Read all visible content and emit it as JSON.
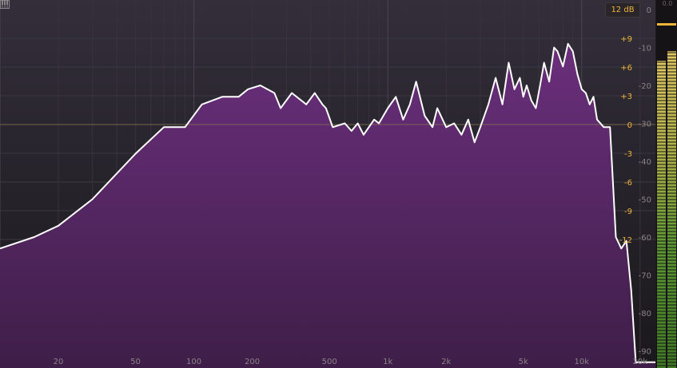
{
  "range_button": {
    "label": "12 dB"
  },
  "meter": {
    "peak_readout": "0.0",
    "level_db": -11
  },
  "freq_axis": {
    "ticks": [
      {
        "label": "20",
        "hz": 20
      },
      {
        "label": "50",
        "hz": 50
      },
      {
        "label": "100",
        "hz": 100
      },
      {
        "label": "200",
        "hz": 200
      },
      {
        "label": "500",
        "hz": 500
      },
      {
        "label": "1k",
        "hz": 1000
      },
      {
        "label": "2k",
        "hz": 2000
      },
      {
        "label": "5k",
        "hz": 5000
      },
      {
        "label": "10k",
        "hz": 10000
      },
      {
        "label": "20k",
        "hz": 20000
      }
    ]
  },
  "eq_scale": {
    "ticks": [
      {
        "label": "+9",
        "db": 9
      },
      {
        "label": "+6",
        "db": 6
      },
      {
        "label": "+3",
        "db": 3
      },
      {
        "label": "0",
        "db": 0
      },
      {
        "label": "-3",
        "db": -3
      },
      {
        "label": "-6",
        "db": -6
      },
      {
        "label": "-9",
        "db": -9
      },
      {
        "label": "-12",
        "db": -12
      }
    ]
  },
  "level_scale": {
    "ticks": [
      {
        "label": "0",
        "db": 0
      },
      {
        "label": "-10",
        "db": -10
      },
      {
        "label": "-20",
        "db": -20
      },
      {
        "label": "-30",
        "db": -30
      },
      {
        "label": "-40",
        "db": -40
      },
      {
        "label": "-50",
        "db": -50
      },
      {
        "label": "-60",
        "db": -60
      },
      {
        "label": "-70",
        "db": -70
      },
      {
        "label": "-80",
        "db": -80
      },
      {
        "label": "-90",
        "db": -90
      }
    ]
  },
  "colors": {
    "background": "#1c1a1f",
    "spectrum_fill": "#5b2a6a",
    "spectrum_line": "#ffffff",
    "accent": "#f0b43a",
    "grid": "#3a3640",
    "meter_yellow": "#d8c060",
    "meter_green": "#4a8a2a"
  },
  "chart_data": {
    "type": "area",
    "x_scale": "log",
    "xlim": [
      10,
      24000
    ],
    "ylim": [
      -93,
      0
    ],
    "x": [
      10,
      15,
      20,
      30,
      50,
      70,
      90,
      110,
      140,
      170,
      190,
      220,
      260,
      280,
      320,
      380,
      420,
      460,
      480,
      520,
      600,
      650,
      700,
      750,
      850,
      900,
      1000,
      1100,
      1200,
      1300,
      1400,
      1550,
      1700,
      1800,
      2000,
      2200,
      2400,
      2600,
      2800,
      3000,
      3300,
      3600,
      3900,
      4200,
      4500,
      4800,
      5000,
      5200,
      5500,
      5800,
      6100,
      6400,
      6800,
      7200,
      7500,
      8000,
      8500,
      9000,
      9500,
      10000,
      10500,
      11000,
      11500,
      12000,
      13000,
      14000,
      15000,
      16000,
      17000,
      18000,
      19000,
      19500,
      20000,
      20500,
      21000,
      21500,
      22000,
      23000,
      24000
    ],
    "y": [
      -63,
      -60,
      -57,
      -50,
      -38,
      -31,
      -31,
      -25,
      -23,
      -23,
      -21,
      -20,
      -22,
      -26,
      -22,
      -25,
      -22,
      -25,
      -26,
      -31,
      -30,
      -32,
      -30,
      -33,
      -29,
      -30,
      -26,
      -23,
      -29,
      -25,
      -19,
      -28,
      -31,
      -26,
      -31,
      -30,
      -33,
      -29,
      -35,
      -31,
      -25,
      -18,
      -25,
      -14,
      -21,
      -18,
      -23,
      -20,
      -24,
      -26,
      -20,
      -14,
      -19,
      -10,
      -11,
      -15,
      -9,
      -11,
      -17,
      -21,
      -22,
      -25,
      -23,
      -29,
      -31,
      -31,
      -60,
      -63,
      -61,
      -74,
      -93,
      -93,
      -93,
      -93,
      -93,
      -93,
      -93,
      -93,
      -93
    ]
  }
}
